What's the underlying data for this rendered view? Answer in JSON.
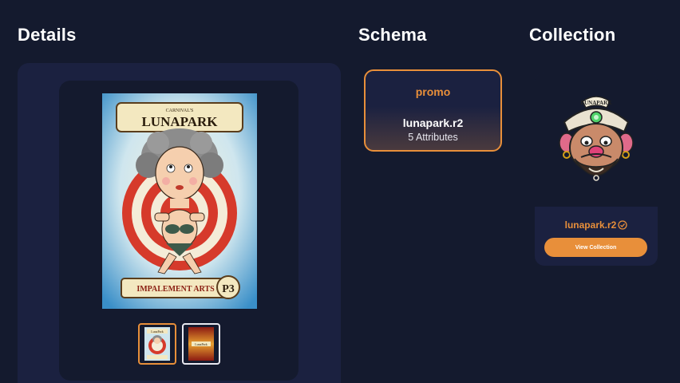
{
  "sections": {
    "details": "Details",
    "schema": "Schema",
    "collection": "Collection"
  },
  "card": {
    "header_small": "CARNIVAL'S",
    "header_title": "LUNAPARK",
    "footer_title": "IMPALEMENT ARTS",
    "footer_code": "P3"
  },
  "thumbnails": {
    "front_label": "LunaPark",
    "back_label": "LunaPark"
  },
  "schema": {
    "tag": "promo",
    "name": "lunapark.r2",
    "attributes": "5 Attributes"
  },
  "collection": {
    "logo_text": "LUNAPARK",
    "name": "lunapark.r2",
    "button_label": "View Collection"
  },
  "colors": {
    "background": "#141a2e",
    "panel": "#1b2140",
    "accent": "#e88f3a"
  },
  "icons": {
    "verified": "check-circle-icon"
  }
}
